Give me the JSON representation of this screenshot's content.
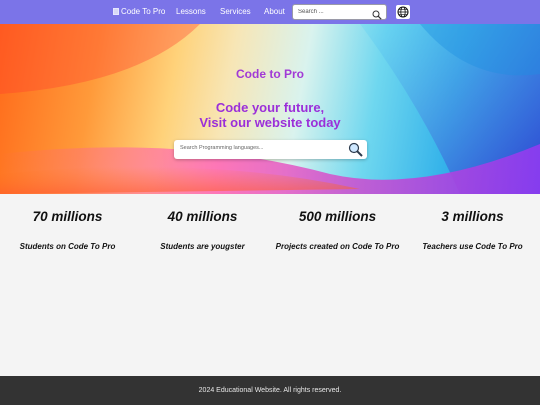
{
  "nav": {
    "logo_alt": "Code To Pro",
    "links": [
      "Lessons",
      "Services",
      "About"
    ],
    "search_placeholder": "Search ...",
    "language_icon": "globe-icon",
    "background": "#7b74e8"
  },
  "hero": {
    "title": "Code to Pro",
    "tagline_line1": "Code your future,",
    "tagline_line2": "Visit our website today",
    "search_placeholder": "Search Programming languages...",
    "accent": "#9b2fd9"
  },
  "stats": [
    {
      "value": "70 millions",
      "label": "Students on Code To Pro"
    },
    {
      "value": "40 millions",
      "label": "Students are yougster"
    },
    {
      "value": "500 millions",
      "label": "Projects created on Code To Pro"
    },
    {
      "value": "3 millions",
      "label": "Teachers use Code To Pro"
    }
  ],
  "footer": {
    "text": "2024 Educational Website. All rights reserved.",
    "background": "#333333"
  }
}
